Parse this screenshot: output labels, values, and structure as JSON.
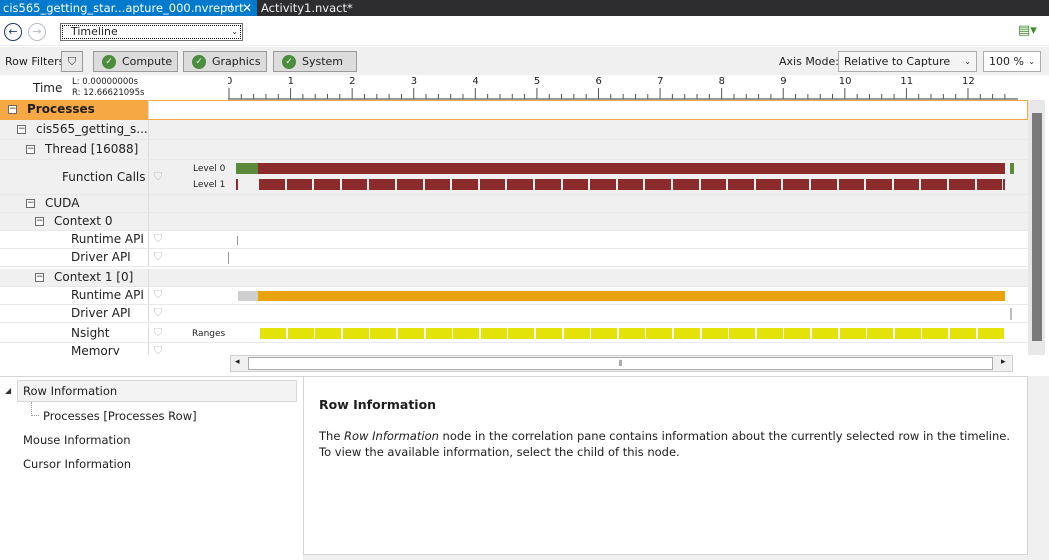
{
  "tabs": [
    {
      "label": "cis565_getting_star...apture_000.nvreport",
      "active": true,
      "pin": "⊣",
      "close": "✕"
    },
    {
      "label": "Activity1.nvact*",
      "active": false
    }
  ],
  "toolbar": {
    "back_icon": "←",
    "forward_icon": "→",
    "view_selector": "Timeline",
    "dropdown_icon": "⌄",
    "report_icon": "▤▾"
  },
  "filters": {
    "row_filters_label": "Row Filters",
    "funnel_icon": "⛉",
    "buttons": [
      {
        "label": "Compute"
      },
      {
        "label": "Graphics"
      },
      {
        "label": "System"
      }
    ],
    "axis_mode_label": "Axis Mode:",
    "axis_mode_value": "Relative to Capture",
    "zoom_value": "100 %"
  },
  "timeline": {
    "time_label": "Time",
    "left_time": "L:  0.00000000s",
    "right_time": "R:  12.66621095s",
    "ticks": [
      "0",
      "1",
      "2",
      "3",
      "4",
      "5",
      "6",
      "7",
      "8",
      "9",
      "10",
      "11",
      "12"
    ],
    "max_seconds": 12.66621095
  },
  "rows": [
    {
      "label": "Processes",
      "expander": "−",
      "selected": true
    },
    {
      "label": "cis565_getting_s...",
      "expander": "−"
    },
    {
      "label": "Thread [16088]",
      "expander": "−"
    },
    {
      "label": "Function Calls",
      "sublabels": [
        "Level 0",
        "Level 1"
      ]
    },
    {
      "label": "CUDA",
      "expander": "−"
    },
    {
      "label": "Context 0",
      "expander": "−"
    },
    {
      "label": "Runtime API"
    },
    {
      "label": "Driver API"
    },
    {
      "label": "Context 1 [0]",
      "expander": "−"
    },
    {
      "label": "Runtime API"
    },
    {
      "label": "Driver API"
    },
    {
      "label": "Nsight",
      "sublabels": [
        "Ranges"
      ]
    },
    {
      "label": "Memory"
    }
  ],
  "colors": {
    "accent": "#007acc",
    "func_call": "#8b2b2b",
    "func_call_start": "#5d8a3a",
    "runtime_api": "#e8a20c",
    "nsight_range": "#e3e30a",
    "selection": "#f5a843"
  },
  "hscroll": {
    "thumb_grip": "⦀",
    "left_arrow": "◂",
    "right_arrow": "▸"
  },
  "tree": {
    "items": [
      {
        "label": "Row Information",
        "selected": true
      },
      {
        "label": "Processes [Processes Row]"
      },
      {
        "label": "Mouse Information"
      },
      {
        "label": "Cursor Information"
      }
    ]
  },
  "info": {
    "title": "Row Information",
    "body_pre": "The ",
    "body_em": "Row Information",
    "body_post": " node in the correlation pane contains information about the currently selected row in the timeline. To view the available information, select the child of this node."
  }
}
